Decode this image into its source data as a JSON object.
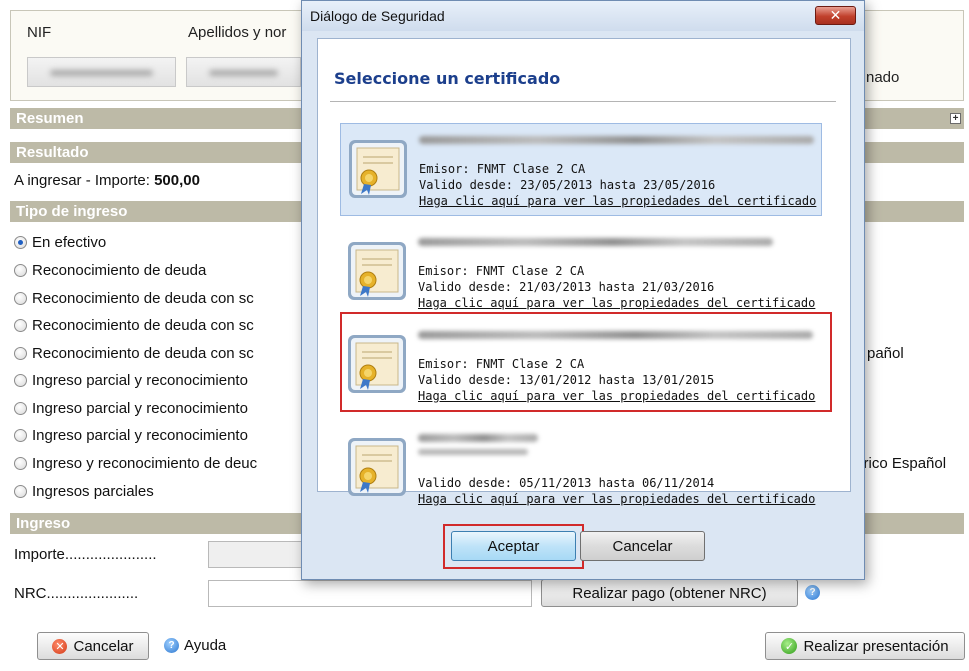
{
  "form": {
    "nif_label": "NIF",
    "apellidos_label": "Apellidos y nor",
    "right_partial_label": "nado",
    "sections": {
      "resumen": "Resumen",
      "resultado": "Resultado",
      "tipo_ingreso": "Tipo de ingreso",
      "ingreso": "Ingreso"
    },
    "resultado_prefix": "A ingresar - Importe: ",
    "resultado_value": "500,00",
    "payment_options": [
      "En efectivo",
      "Reconocimiento de deuda",
      "Reconocimiento de deuda con sc",
      "Reconocimiento de deuda con sc",
      "Reconocimiento de deuda con sc",
      "Ingreso parcial y reconocimiento",
      "Ingreso parcial y reconocimiento",
      "Ingreso parcial y reconocimiento",
      "Ingreso y reconocimiento de deuc",
      "Ingresos parciales"
    ],
    "selected_option": "En efectivo",
    "option_right_fragments": {
      "espanol": "pañol",
      "historico": "tórico Español"
    },
    "importe_label": "Importe",
    "nrc_label": "NRC",
    "dot_leader": "......................",
    "importe_value": "",
    "nrc_value": "",
    "realizar_pago_label": "Realizar pago (obtener NRC)",
    "cancelar_label": "Cancelar",
    "ayuda_label": "Ayuda",
    "realizar_presentacion_label": "Realizar presentación"
  },
  "dialog": {
    "title": "Diálogo de Seguridad",
    "heading": "Seleccione un certificado",
    "certificates": [
      {
        "emisor": "Emisor: FNMT Clase 2 CA",
        "validez": "Valido desde: 23/05/2013 hasta 23/05/2016",
        "link": "Haga clic aquí para ver las propiedades del certificado"
      },
      {
        "emisor": "Emisor: FNMT Clase 2 CA",
        "validez": "Valido desde: 21/03/2013 hasta 21/03/2016",
        "link": "Haga clic aquí para ver las propiedades del certificado"
      },
      {
        "emisor": "Emisor: FNMT Clase 2 CA",
        "validez": "Valido desde: 13/01/2012 hasta 13/01/2015",
        "link": "Haga clic aquí para ver las propiedades del certificado"
      },
      {
        "emisor": "",
        "validez": "Valido desde: 05/11/2013 hasta 06/11/2014",
        "link": "Haga clic aquí para ver las propiedades del certificado"
      }
    ],
    "accept_label": "Aceptar",
    "cancel_label": "Cancelar",
    "close_glyph": "✕"
  },
  "colors": {
    "section_band": "#bdbaa7",
    "dialog_heading": "#1c3f8c",
    "highlight_red": "#d12a2a",
    "selected_row": "#dbe8f7"
  },
  "icons": {
    "certificate": "certificate-icon",
    "close": "close-icon",
    "cancel": "cancel-icon",
    "help": "help-icon",
    "ok": "checkmark-icon",
    "expand": "plus-icon"
  }
}
